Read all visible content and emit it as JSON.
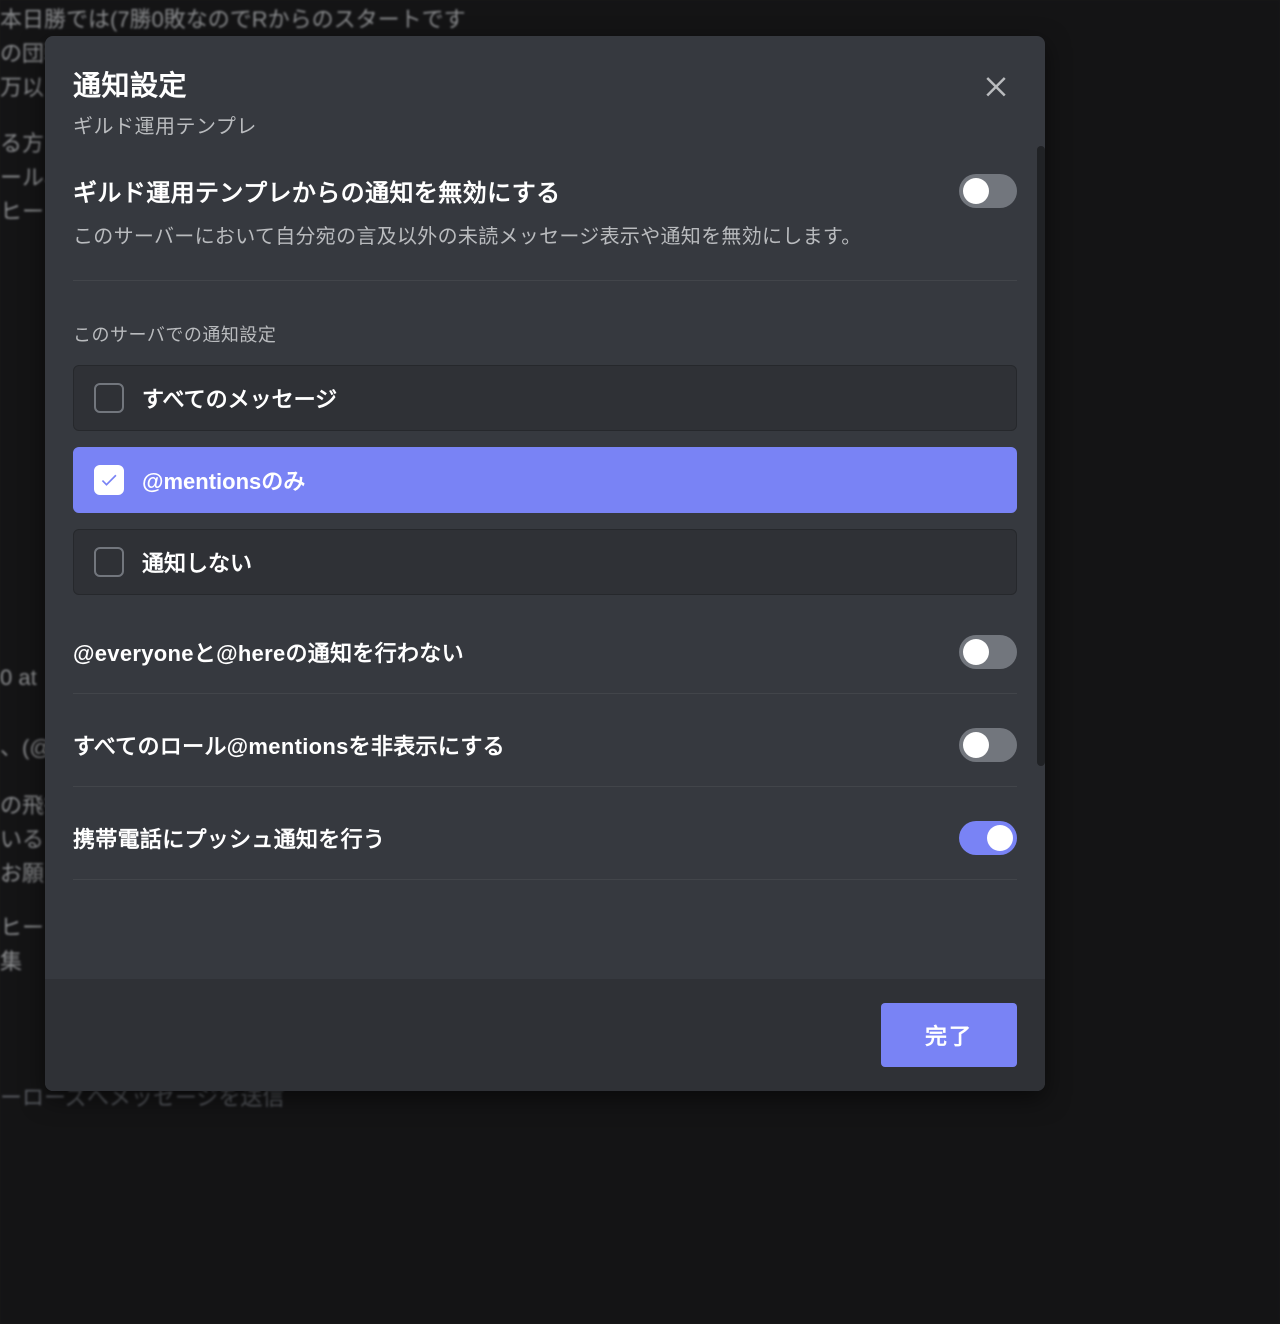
{
  "modal": {
    "title": "通知設定",
    "subtitle": "ギルド運用テンプレ",
    "mute": {
      "title": "ギルド運用テンプレからの通知を無効にする",
      "description": "このサーバーにおいて自分宛の言及以外の未読メッセージ表示や通知を無効にします。",
      "enabled": false
    },
    "notification_section_label": "このサーバでの通知設定",
    "options": [
      {
        "label": "すべてのメッセージ",
        "selected": false
      },
      {
        "label": "@mentionsのみ",
        "selected": true
      },
      {
        "label": "通知しない",
        "selected": false
      }
    ],
    "toggles": [
      {
        "label": "@everyoneと@hereの通知を行わない",
        "enabled": false
      },
      {
        "label": "すべてのロール@mentionsを非表示にする",
        "enabled": false
      },
      {
        "label": "携帯電話にプッシュ通知を行う",
        "enabled": true
      }
    ],
    "done_label": "完了"
  },
  "background_snippets": [
    "本日勝では(7勝0敗なのでRからのスタートです",
    "の団戦",
    "万以",
    "る方い",
    "ール、",
    "ヒー",
    "0 at",
    "、(@",
    "の飛行",
    "いる",
    "お願い",
    "ヒー",
    "集",
    "ーローズへメッセージを送信"
  ]
}
